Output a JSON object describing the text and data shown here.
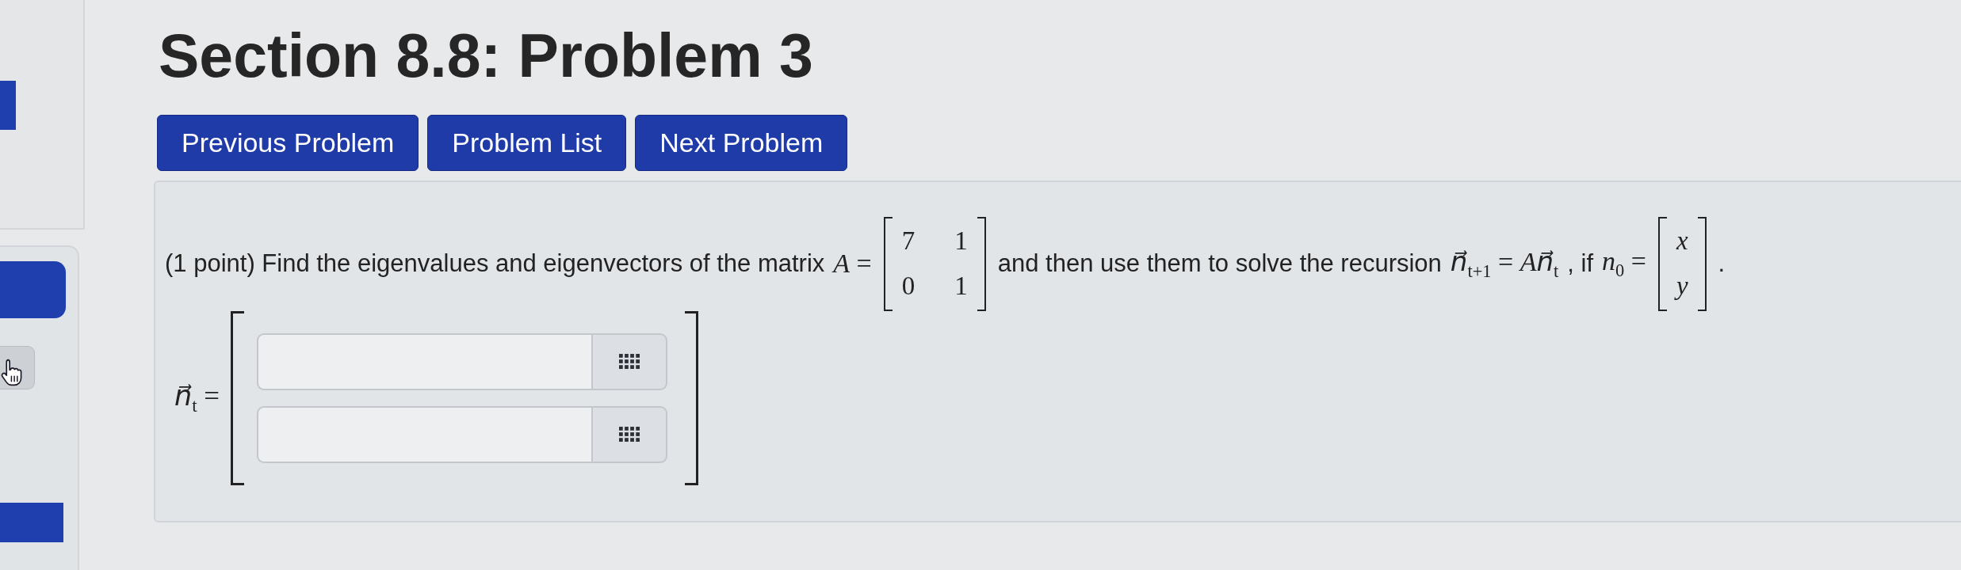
{
  "heading": {
    "title": "Section 8.8: Problem 3"
  },
  "nav_buttons": [
    {
      "label": "Previous Problem"
    },
    {
      "label": "Problem List"
    },
    {
      "label": "Next Problem"
    }
  ],
  "problem": {
    "statement": [
      {
        "kind": "text",
        "text": "(1 point) Find the eigenvalues and eigenvectors of the matrix"
      },
      {
        "kind": "math",
        "text": "*A* ="
      },
      {
        "kind": "matrix",
        "rows": [
          [
            "7",
            "1"
          ],
          [
            "0",
            "1"
          ]
        ]
      },
      {
        "kind": "text",
        "text": "and then use them to solve the recursion"
      },
      {
        "kind": "math",
        "text": "*n⃗*$_{t+1}$ = *An⃗*$_{t}$"
      },
      {
        "kind": "text",
        "text": ", if"
      },
      {
        "kind": "math",
        "text": "*n*$_{0}$ ="
      },
      {
        "kind": "matrix",
        "rows": [
          [
            "*x*"
          ],
          [
            "*y*"
          ]
        ]
      },
      {
        "kind": "text",
        "text": "."
      }
    ],
    "answer": {
      "label": "*n⃗*$_{t}$ =",
      "fields": [
        {
          "kind": "input_with_editor"
        },
        {
          "kind": "input_with_editor"
        }
      ]
    }
  }
}
